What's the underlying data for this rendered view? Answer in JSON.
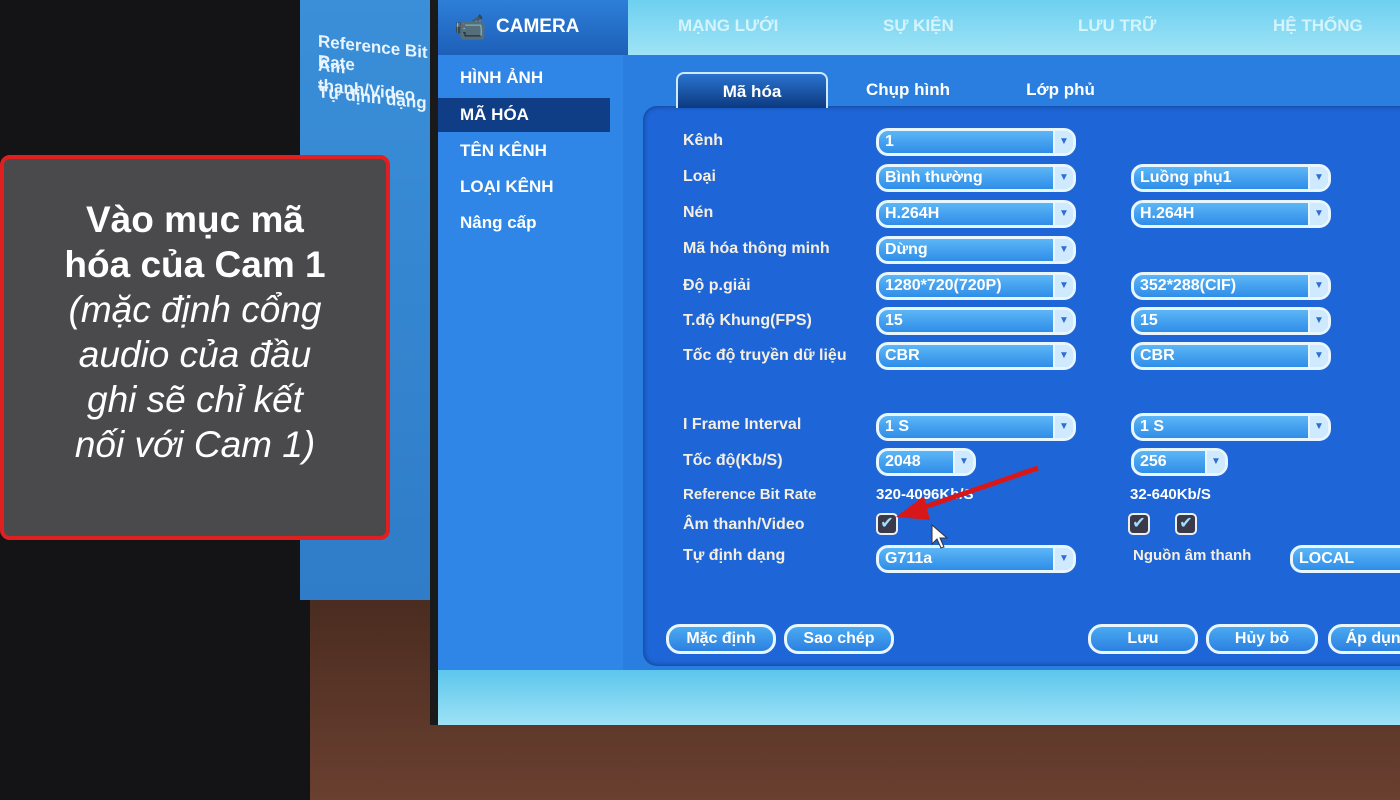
{
  "background_screen": {
    "lines": [
      "Reference Bit Rate",
      "Âm thanh/Video",
      "Tự định dạng"
    ]
  },
  "topbar": {
    "camera": "CAMERA",
    "items": [
      "MẠNG LƯỚI",
      "SỰ KIỆN",
      "LƯU TRỮ",
      "HỆ THỐNG"
    ]
  },
  "sidebar": {
    "items": [
      "HÌNH ẢNH",
      "MÃ HÓA",
      "TÊN KÊNH",
      "LOẠI KÊNH",
      "Nâng cấp"
    ],
    "selected": "MÃ HÓA"
  },
  "tabs": [
    "Mã hóa",
    "Chụp hình",
    "Lớp phủ"
  ],
  "form": {
    "labels": [
      "Kênh",
      "Loại",
      "Nén",
      "Mã hóa thông minh",
      "Độ p.giải",
      "T.độ Khung(FPS)",
      "Tốc độ truyền dữ liệu",
      "I Frame Interval",
      "Tốc độ(Kb/S)",
      "Reference Bit Rate",
      "Âm thanh/Video",
      "Tự định dạng"
    ],
    "main": {
      "kenh": "1",
      "loai": "Bình thường",
      "nen": "H.264H",
      "ma_hoa_thong_minh": "Dừng",
      "do_phan_giai": "1280*720(720P)",
      "fps": "15",
      "bitrate_mode": "CBR",
      "iframe": "1 S",
      "toc_do": "2048",
      "ref_bitrate": "320-4096Kb/S",
      "audio_video": true
    },
    "sub": {
      "loai": "Luồng phụ1",
      "nen": "H.264H",
      "do_phan_giai": "352*288(CIF)",
      "fps": "15",
      "bitrate_mode": "CBR",
      "iframe": "1 S",
      "toc_do": "256",
      "ref_bitrate": "32-640Kb/S",
      "audio": true,
      "video": true
    },
    "audio_format": "G711a",
    "audio_source_label": "Nguồn âm thanh",
    "audio_source": "LOCAL"
  },
  "buttons": {
    "default": "Mặc định",
    "copy": "Sao chép",
    "save": "Lưu",
    "cancel": "Hủy bỏ",
    "apply": "Áp dụng"
  },
  "callout": {
    "line1": "Vào mục mã",
    "line2": "hóa của Cam 1",
    "italic": [
      "(mặc định cổng",
      "audio của đầu",
      "ghi sẽ chỉ kết",
      "nối với Cam 1)"
    ]
  },
  "colors": {
    "accent": "#1e66d8",
    "callout_border": "#e02020",
    "arrow": "#d81818"
  }
}
